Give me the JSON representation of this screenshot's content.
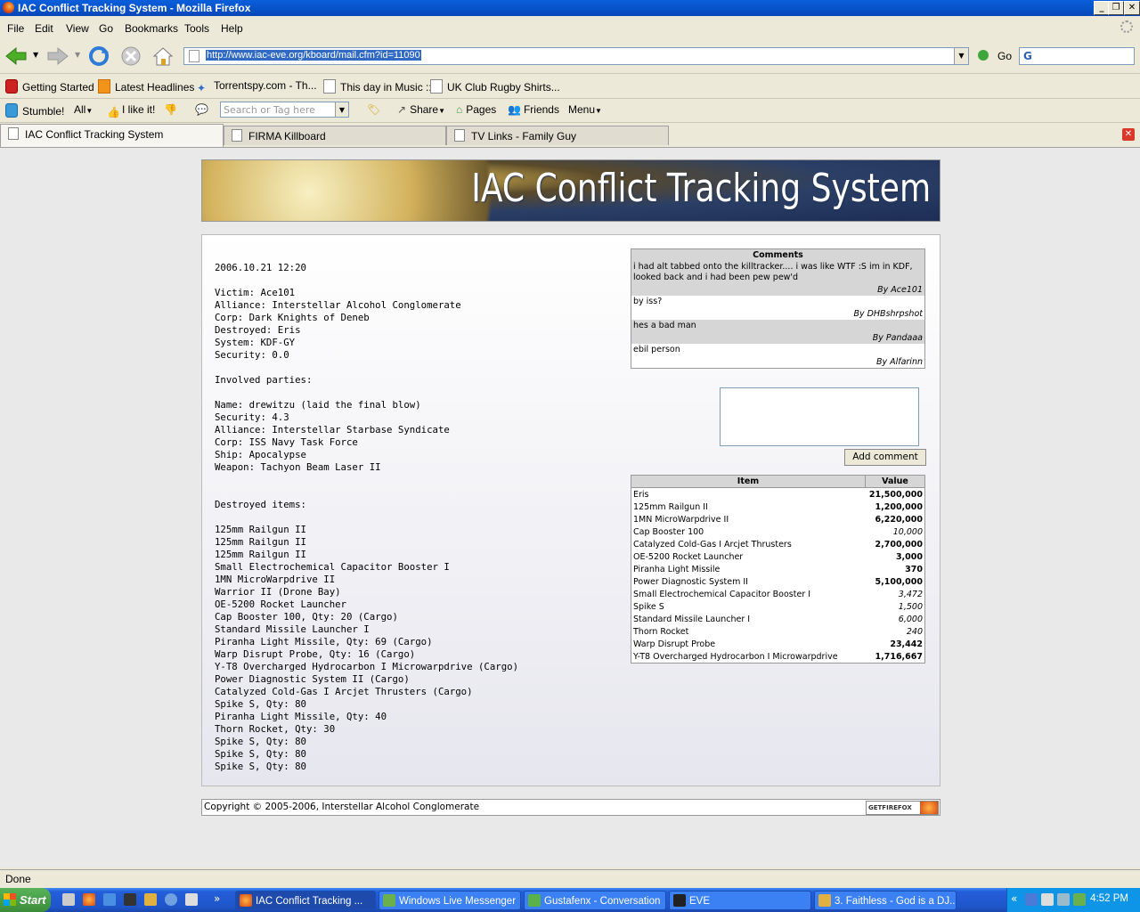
{
  "window": {
    "title": "IAC Conflict Tracking System - Mozilla Firefox",
    "buttons": [
      "_",
      "❐",
      "✕"
    ]
  },
  "menu": [
    "File",
    "Edit",
    "View",
    "Go",
    "Bookmarks",
    "Tools",
    "Help"
  ],
  "nav": {
    "url": "http://www.iac-eve.org/kboard/mail.cfm?id=11090",
    "go_label": "Go"
  },
  "bookmarks": [
    "Getting Started",
    "Latest Headlines",
    "Torrentspy.com - Th...",
    "This day in Music ::",
    "UK Club Rugby Shirts..."
  ],
  "stumble": {
    "stumble": "Stumble!",
    "all": "All",
    "like": "I like it!",
    "search_placeholder": "Search or Tag here",
    "share": "Share",
    "pages": "Pages",
    "friends": "Friends",
    "menu": "Menu"
  },
  "tabs": [
    "IAC Conflict Tracking System",
    "FIRMA Killboard",
    "TV Links - Family Guy"
  ],
  "page": {
    "banner": "IAC Conflict Tracking System",
    "killmail": "2006.10.21 12:20\n\nVictim: Ace101\nAlliance: Interstellar Alcohol Conglomerate\nCorp: Dark Knights of Deneb\nDestroyed: Eris\nSystem: KDF-GY\nSecurity: 0.0\n\nInvolved parties:\n\nName: drewitzu (laid the final blow)\nSecurity: 4.3\nAlliance: Interstellar Starbase Syndicate\nCorp: ISS Navy Task Force\nShip: Apocalypse\nWeapon: Tachyon Beam Laser II\n\n\nDestroyed items:\n\n125mm Railgun II\n125mm Railgun II\n125mm Railgun II\nSmall Electrochemical Capacitor Booster I\n1MN MicroWarpdrive II\nWarrior II (Drone Bay)\nOE-5200 Rocket Launcher\nCap Booster 100, Qty: 20 (Cargo)\nStandard Missile Launcher I\nPiranha Light Missile, Qty: 69 (Cargo)\nWarp Disrupt Probe, Qty: 16 (Cargo)\nY-T8 Overcharged Hydrocarbon I Microwarpdrive (Cargo)\nPower Diagnostic System II (Cargo)\nCatalyzed Cold-Gas I Arcjet Thrusters (Cargo)\nSpike S, Qty: 80\nPiranha Light Missile, Qty: 40\nThorn Rocket, Qty: 30\nSpike S, Qty: 80\nSpike S, Qty: 80\nSpike S, Qty: 80",
    "comments_header": "Comments",
    "comments": [
      {
        "text": "i had alt tabbed onto the killtracker.... i was like WTF :S im in KDF, looked back and i had been pew pew'd",
        "by": "By Ace101"
      },
      {
        "text": "by iss?",
        "by": "By DHBshrpshot"
      },
      {
        "text": "hes a bad man",
        "by": "By Pandaaa"
      },
      {
        "text": "ebil person",
        "by": "By Alfarinn"
      }
    ],
    "add_comment": "Add comment",
    "items_header": {
      "item": "Item",
      "value": "Value"
    },
    "items": [
      {
        "item": "Eris",
        "value": "21,500,000",
        "style": "b"
      },
      {
        "item": "125mm Railgun II",
        "value": "1,200,000",
        "style": "b"
      },
      {
        "item": "1MN MicroWarpdrive II",
        "value": "6,220,000",
        "style": "b"
      },
      {
        "item": "Cap Booster 100",
        "value": "10,000",
        "style": "i"
      },
      {
        "item": "Catalyzed Cold-Gas I Arcjet Thrusters",
        "value": "2,700,000",
        "style": "b"
      },
      {
        "item": "OE-5200 Rocket Launcher",
        "value": "3,000",
        "style": "b"
      },
      {
        "item": "Piranha Light Missile",
        "value": "370",
        "style": "b"
      },
      {
        "item": "Power Diagnostic System II",
        "value": "5,100,000",
        "style": "b"
      },
      {
        "item": "Small Electrochemical Capacitor Booster I",
        "value": "3,472",
        "style": "i"
      },
      {
        "item": "Spike S",
        "value": "1,500",
        "style": "i"
      },
      {
        "item": "Standard Missile Launcher I",
        "value": "6,000",
        "style": "i"
      },
      {
        "item": "Thorn Rocket",
        "value": "240",
        "style": "i"
      },
      {
        "item": "Warp Disrupt Probe",
        "value": "23,442",
        "style": "b"
      },
      {
        "item": "Y-T8 Overcharged Hydrocarbon I Microwarpdrive",
        "value": "1,716,667",
        "style": "b"
      }
    ],
    "footer": "Copyright © 2005-2006, Interstellar Alcohol Conglomerate",
    "getfirefox": "GETFIREFOX"
  },
  "status": "Done",
  "taskbar": {
    "start": "Start",
    "more": "»",
    "tasks": [
      "IAC Conflict Tracking ...",
      "Windows Live Messenger",
      "Gustafenx - Conversation",
      "EVE",
      "3. Faithless - God is a DJ..."
    ],
    "tray_more": "«",
    "clock": "4:52 PM"
  },
  "colors": {
    "titlebar": "#0a5fdc",
    "chrome": "#ece9d8",
    "taskbar": "#245edb",
    "start": "#3b8c3a"
  }
}
